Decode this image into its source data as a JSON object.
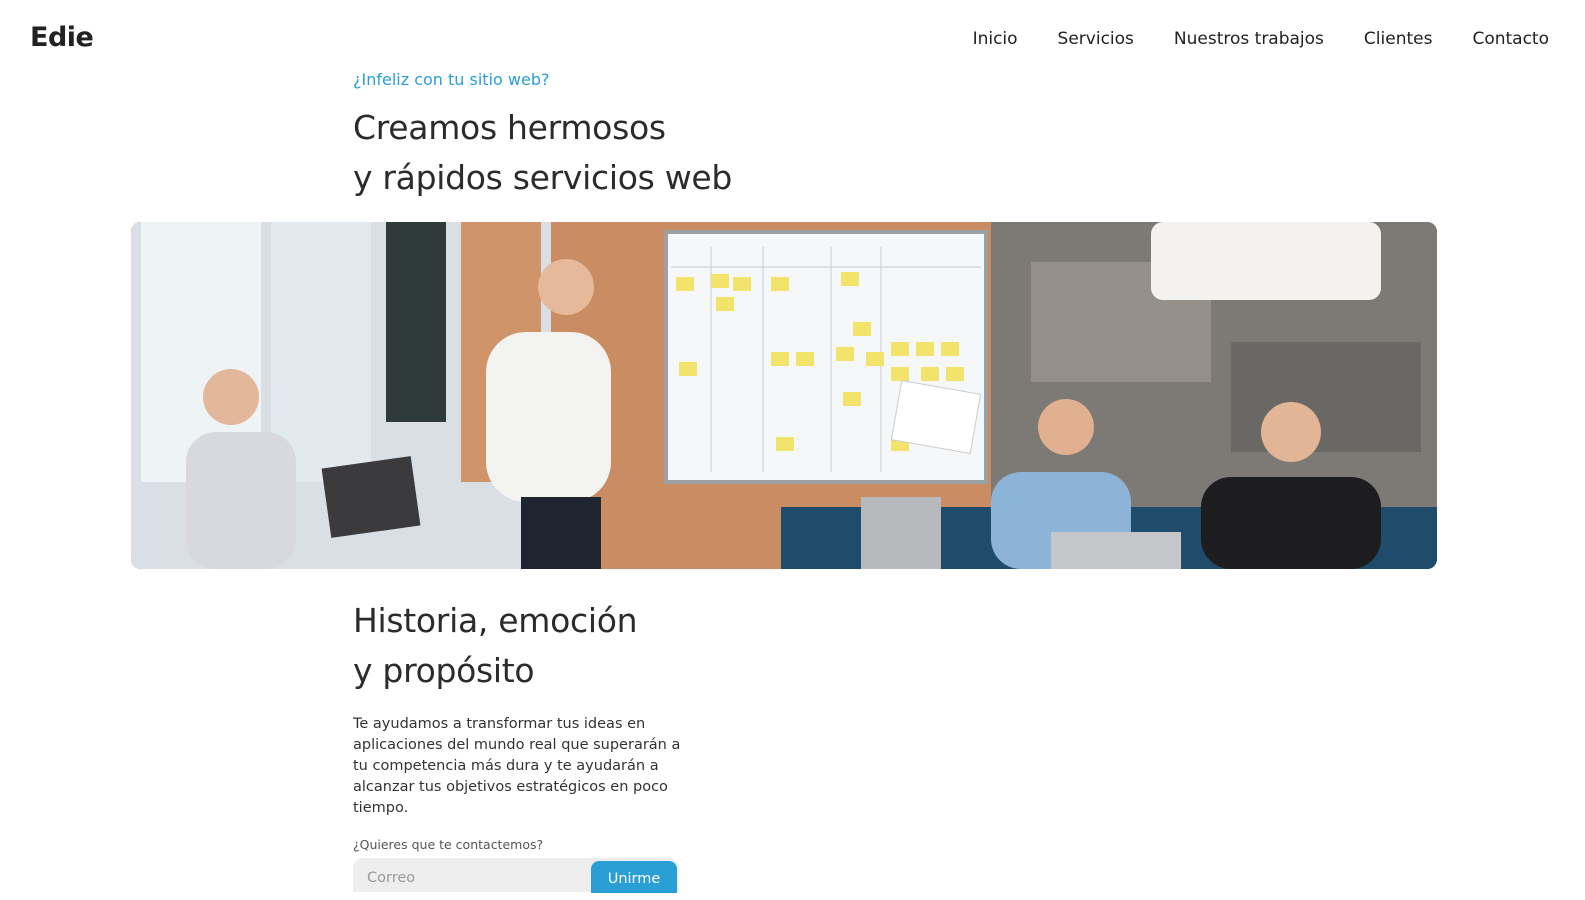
{
  "brand": "Edie",
  "nav": {
    "items": [
      "Inicio",
      "Servicios",
      "Nuestros trabajos",
      "Clientes",
      "Contacto"
    ]
  },
  "hero": {
    "eyebrow": "¿Infeliz con tu sitio web?",
    "title_line1": "Creamos hermosos",
    "title_line2": "y rápidos servicios web"
  },
  "section": {
    "title_line1": "Historia, emoción",
    "title_line2": "y propósito",
    "body": "Te ayudamos a transformar tus ideas en aplicaciones del mundo real que superarán a tu competencia más dura y te ayudarán a alcanzar tus objetivos estratégicos en poco tiempo.",
    "contact_label": "¿Quieres que te contactemos?",
    "email_placeholder": "Correo",
    "submit_label": "Unirme"
  },
  "colors": {
    "accent": "#2a9fd6",
    "text": "#2b2b2b"
  }
}
